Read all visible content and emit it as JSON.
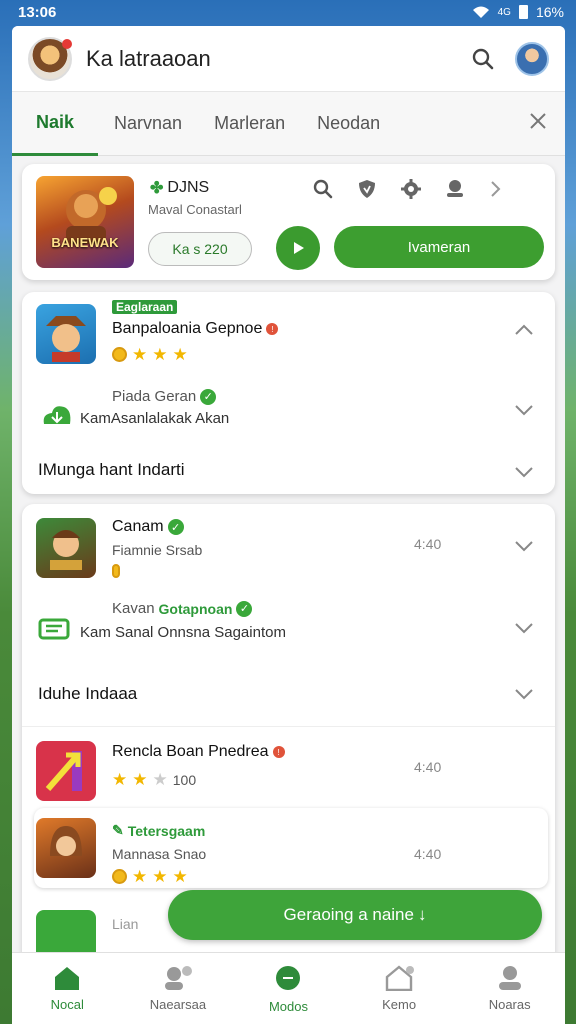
{
  "status": {
    "time": "13:06",
    "signal": "4G",
    "battery": "16%"
  },
  "header": {
    "title": "Ka latraaoan"
  },
  "tabs": [
    {
      "label": "Naik"
    },
    {
      "label": "Narvnan"
    },
    {
      "label": "Marleran"
    },
    {
      "label": "Neodan"
    }
  ],
  "hero": {
    "cover_text": "BANEWAK",
    "title": "DJNS",
    "subtitle": "Maval Conastarl",
    "price": "Ka s 220",
    "install_label": "Ivameran"
  },
  "section1": {
    "app": {
      "tag": "Eaglaraan",
      "name": "Banpaloania Gepnoe",
      "rating_stars": 3
    },
    "row2": {
      "title": "Piada Geran",
      "subtitle": "KamAsanlalakak Akan"
    },
    "row3": {
      "title": "IMunga hant Indarti"
    }
  },
  "section2": {
    "app1": {
      "name": "Canam",
      "subtitle": "Fiamnie Srsab",
      "right": "4:40"
    },
    "row2": {
      "title_prefix": "Kavan",
      "title_green": "Gotapnoan",
      "subtitle": "Kam Sanal Onnsna Sagaintom"
    },
    "row3": {
      "title": "Iduhe Indaaa"
    },
    "app2": {
      "name": "Rencla Boan Pnedrea",
      "rating_text": "100",
      "rating_stars": 2,
      "right": "4:40"
    },
    "app3": {
      "tag": "Tetersgaam",
      "subtitle": "Mannasa Snao",
      "right": "4:40",
      "rating_stars": 3
    },
    "app4": {
      "name": "Lian"
    }
  },
  "cta": {
    "label": "Geraoing a naine"
  },
  "nav": [
    {
      "label": "Nocal",
      "icon": "home-icon"
    },
    {
      "label": "Naearsaa",
      "icon": "people-icon"
    },
    {
      "label": "Modos",
      "icon": "message-icon"
    },
    {
      "label": "Kemo",
      "icon": "house-outline-icon"
    },
    {
      "label": "Noaras",
      "icon": "person-icon"
    }
  ],
  "colors": {
    "accent": "#3d9e30",
    "brand_dark": "#1e7a2e",
    "star": "#f2b700"
  }
}
